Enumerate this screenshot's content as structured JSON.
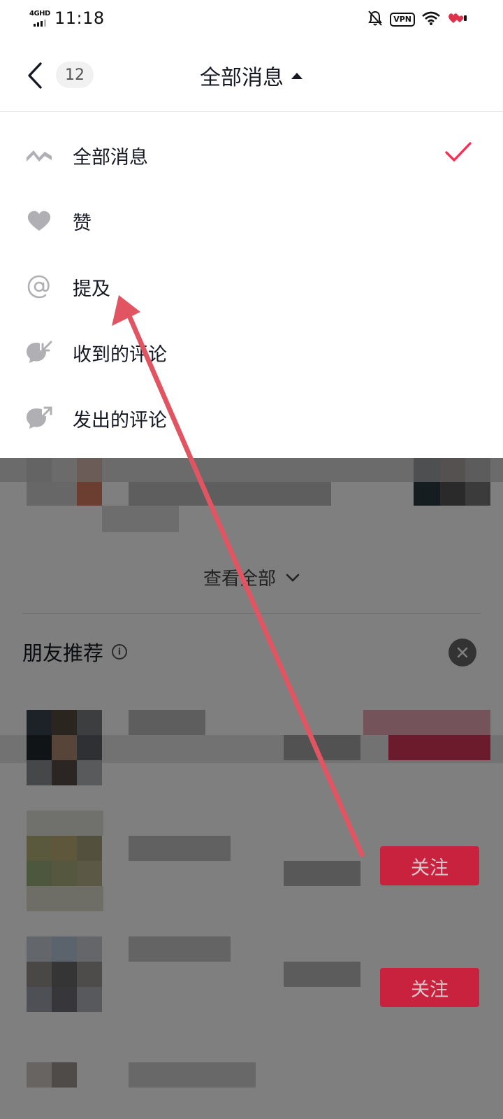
{
  "status_bar": {
    "network": "4GHD",
    "time": "11:18",
    "vpn": "VPN"
  },
  "header": {
    "unread_count": "12",
    "title": "全部消息"
  },
  "menu": {
    "items": [
      {
        "label": "全部消息",
        "icon": "activity-icon",
        "selected": true
      },
      {
        "label": "赞",
        "icon": "heart-icon",
        "selected": false
      },
      {
        "label": "提及",
        "icon": "at-icon",
        "selected": false
      },
      {
        "label": "收到的评论",
        "icon": "comment-received-icon",
        "selected": false
      },
      {
        "label": "发出的评论",
        "icon": "comment-sent-icon",
        "selected": false
      }
    ]
  },
  "background": {
    "view_all": "查看全部",
    "friend_suggest_title": "朋友推荐",
    "follow_label": "关注"
  },
  "colors": {
    "accent": "#fe2c55",
    "arrow": "#e05561",
    "overlay": "rgba(0,0,0,0.5)"
  }
}
